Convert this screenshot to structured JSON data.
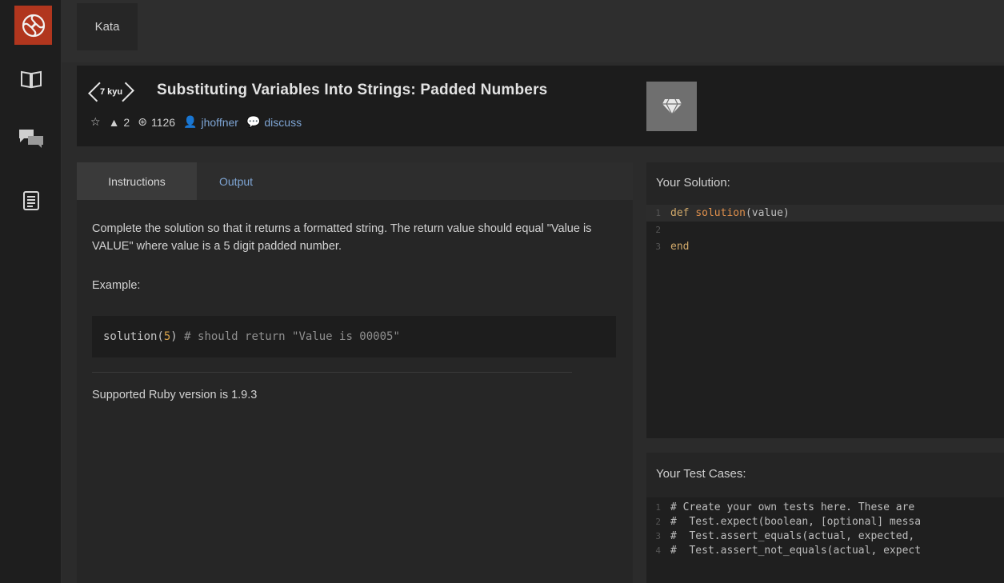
{
  "top_tab": {
    "label": "Kata"
  },
  "kata": {
    "rank": "7 kyu",
    "title": "Substituting Variables Into Strings: Padded Numbers",
    "votes": "2",
    "completed": "1126",
    "author": "jhoffner",
    "discuss": "discuss"
  },
  "tabs": {
    "instructions": "Instructions",
    "output": "Output"
  },
  "instructions": {
    "description": "Complete the solution so that it returns a formatted string. The return value should equal \"Value is VALUE\" where value is a 5 digit padded number.",
    "example_label": "Example:",
    "code_fn": "solution(",
    "code_num": "5",
    "code_close": ")",
    "code_comment": " # should return \"Value is 00005\"",
    "ruby_note": "Supported Ruby version is 1.9.3"
  },
  "solution": {
    "title": "Your Solution:",
    "line1_kw": "def ",
    "line1_fn": "solution",
    "line1_rest": "(value)",
    "line3": "end",
    "n1": "1",
    "n2": "2",
    "n3": "3"
  },
  "tests": {
    "title": "Your Test Cases:",
    "l1": "# Create your own tests here. These are",
    "l2": "#  Test.expect(boolean, [optional] messa",
    "l3": "#  Test.assert_equals(actual, expected,",
    "l4": "#  Test.assert_not_equals(actual, expect",
    "n1": "1",
    "n2": "2",
    "n3": "3",
    "n4": "4"
  },
  "colors": {
    "brand": "#b1361e",
    "link": "#7ea5d4"
  }
}
